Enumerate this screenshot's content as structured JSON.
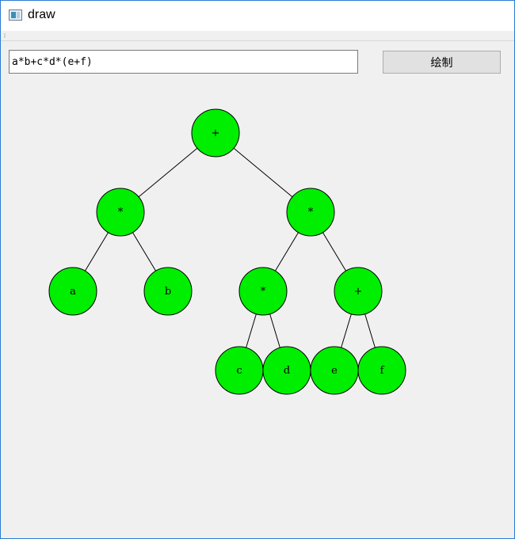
{
  "window": {
    "title": "draw"
  },
  "input": {
    "value": "a*b+c*d*(e+f)"
  },
  "toolbar": {
    "draw_label": "绘制"
  },
  "tree": {
    "node_color": "#00ee00",
    "root": {
      "label": "+",
      "children": [
        {
          "label": "*",
          "children": [
            {
              "label": "a"
            },
            {
              "label": "b"
            }
          ]
        },
        {
          "label": "*",
          "children": [
            {
              "label": "*",
              "children": [
                {
                  "label": "c"
                },
                {
                  "label": "d"
                }
              ]
            },
            {
              "label": "+",
              "children": [
                {
                  "label": "e"
                },
                {
                  "label": "f"
                }
              ]
            }
          ]
        }
      ]
    }
  }
}
